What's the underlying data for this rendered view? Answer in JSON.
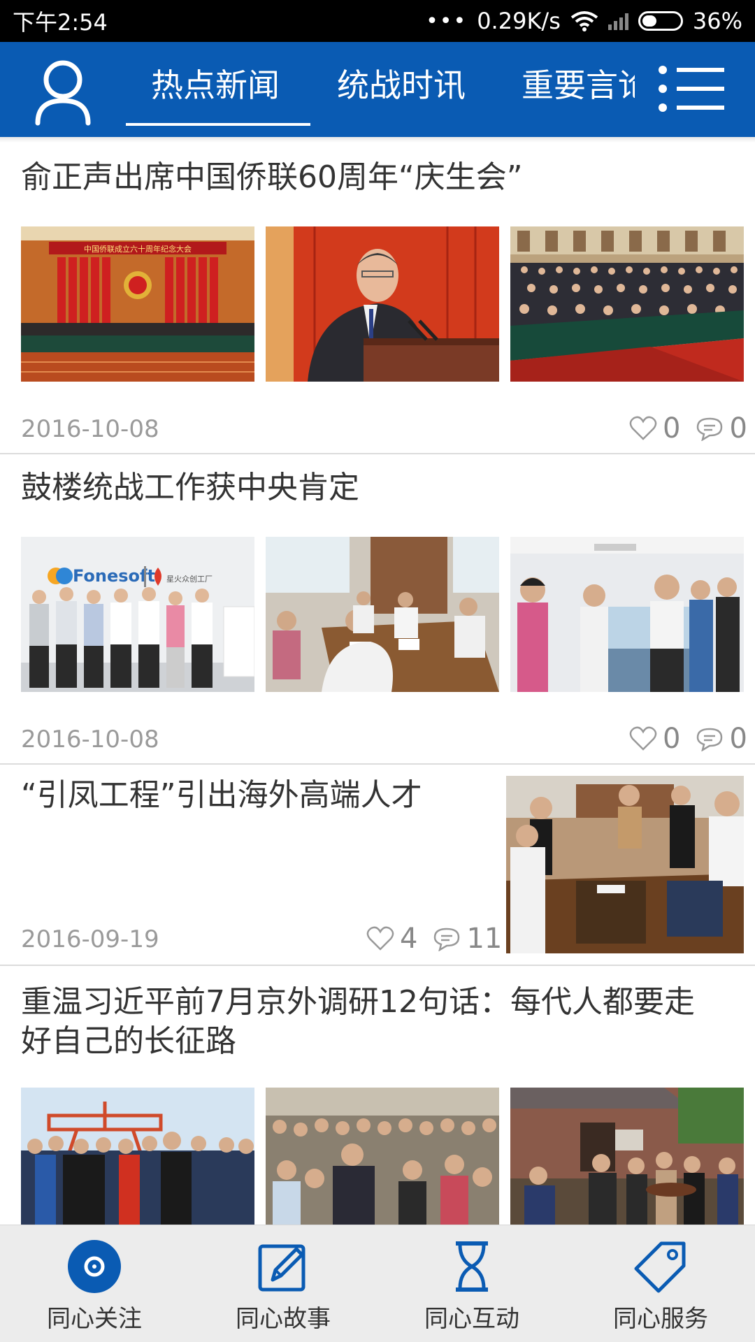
{
  "status_bar": {
    "time": "下午2:54",
    "network_speed": "0.29K/s",
    "battery": "36%"
  },
  "header": {
    "tabs": [
      {
        "label": "热点新闻",
        "active": true
      },
      {
        "label": "统战时讯",
        "active": false
      },
      {
        "label": "重要言论",
        "active": false
      }
    ],
    "accent_color": "#0a5bb3"
  },
  "articles": [
    {
      "title": "俞正声出席中国侨联60周年“庆生会”",
      "date": "2016-10-08",
      "likes": "0",
      "comments": "0"
    },
    {
      "title": "鼓楼统战工作获中央肯定",
      "date": "2016-10-08",
      "likes": "0",
      "comments": "0"
    },
    {
      "title": "“引凤工程”引出海外高端人才",
      "date": "2016-09-19",
      "likes": "4",
      "comments": "11"
    },
    {
      "title_line1": "重温习近平前7月京外调研12句话：每代人都要走",
      "title_line2": "好自己的长征路"
    }
  ],
  "photo_captions": {
    "hall_banner": "中国侨联成立六十周年纪念大会",
    "company_sign": "Fonesoft",
    "company_sign_cn": "星火众创工厂"
  },
  "bottom_nav": {
    "items": [
      {
        "label": "同心关注",
        "icon": "focus-icon",
        "active": true
      },
      {
        "label": "同心故事",
        "icon": "edit-icon",
        "active": false
      },
      {
        "label": "同心互动",
        "icon": "hourglass-icon",
        "active": false
      },
      {
        "label": "同心服务",
        "icon": "tag-icon",
        "active": false
      }
    ]
  }
}
